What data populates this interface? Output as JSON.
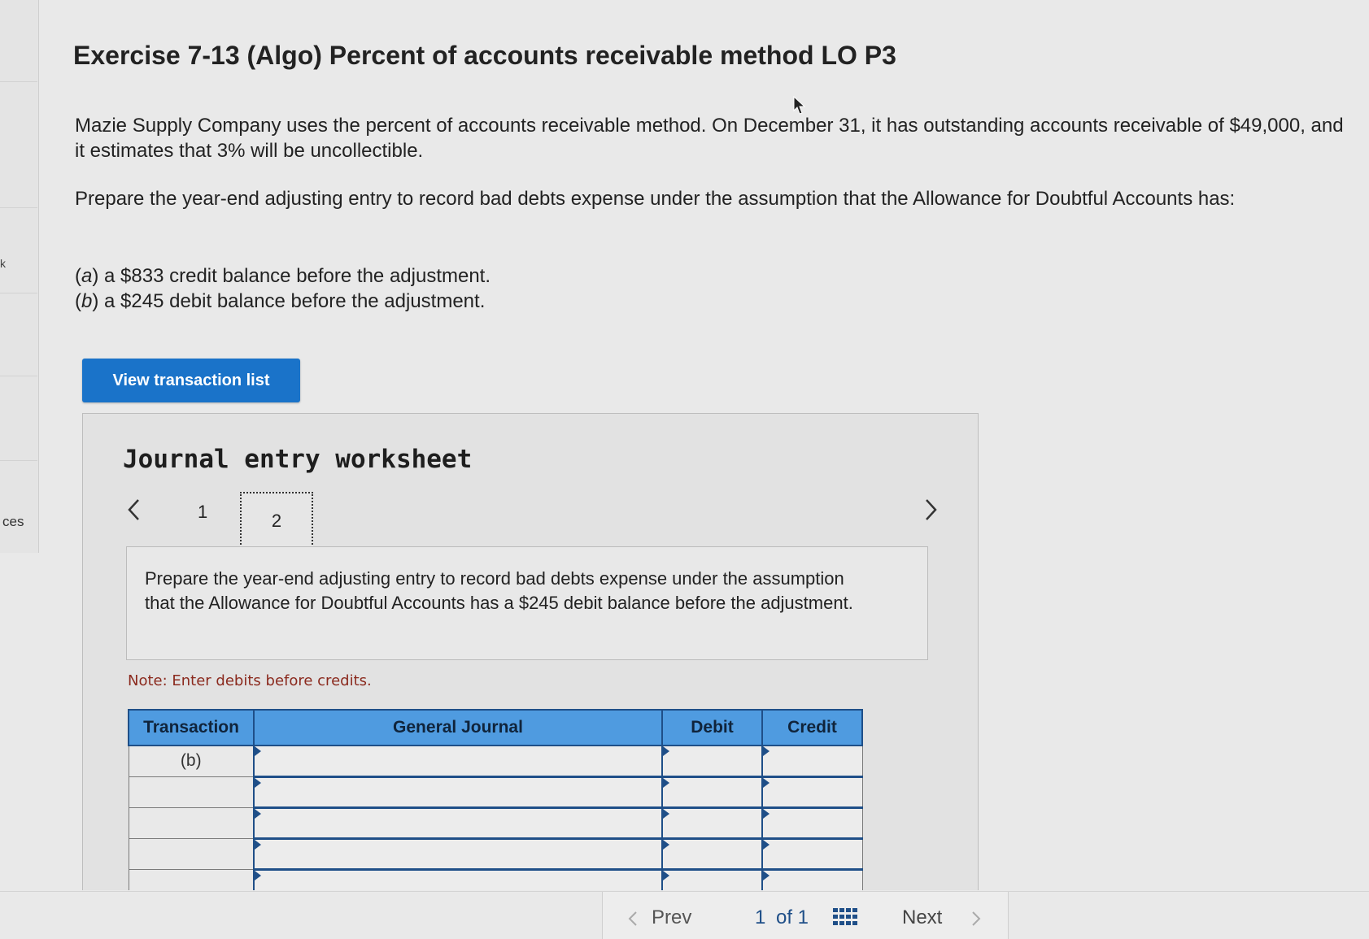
{
  "left_rail": {
    "label": "ces",
    "mark": "k"
  },
  "exercise": {
    "title": "Exercise 7-13 (Algo) Percent of accounts receivable method LO P3",
    "paragraph1": "Mazie Supply Company uses the percent of accounts receivable method. On December 31, it has outstanding accounts receivable of $49,000, and it estimates that 3% will be uncollectible.",
    "paragraph2": "Prepare the year-end adjusting entry to record bad debts expense under the assumption that the Allowance for Doubtful Accounts has:",
    "options": [
      {
        "letter": "a",
        "text": " a $833 credit balance before the adjustment."
      },
      {
        "letter": "b",
        "text": " a $245 debit balance before the adjustment."
      }
    ]
  },
  "view_transactions_label": "View transaction list",
  "worksheet": {
    "title": "Journal entry worksheet",
    "steps": [
      "1",
      "2"
    ],
    "active_step": "2",
    "instruction": "Prepare the year-end adjusting entry to record bad debts expense under the assumption that the Allowance for Doubtful Accounts has a $245 debit balance before the adjustment.",
    "note": "Note: Enter debits before credits.",
    "table": {
      "headers": {
        "transaction": "Transaction",
        "general_journal": "General Journal",
        "debit": "Debit",
        "credit": "Credit"
      },
      "rows": [
        {
          "transaction": "(b)",
          "account": "",
          "debit": "",
          "credit": ""
        },
        {
          "transaction": "",
          "account": "",
          "debit": "",
          "credit": ""
        },
        {
          "transaction": "",
          "account": "",
          "debit": "",
          "credit": ""
        },
        {
          "transaction": "",
          "account": "",
          "debit": "",
          "credit": ""
        },
        {
          "transaction": "",
          "account": "",
          "debit": "",
          "credit": ""
        }
      ]
    }
  },
  "pager": {
    "prev_label": "Prev",
    "current": "1",
    "of_label": "of 1",
    "next_label": "Next"
  },
  "colors": {
    "primary_button": "#1a73c9",
    "table_header": "#4f9be0",
    "note_text": "#8b2a1e"
  },
  "icons": [
    "cursor-arrow-icon",
    "chevron-left-icon",
    "chevron-right-icon",
    "grid-icon"
  ]
}
